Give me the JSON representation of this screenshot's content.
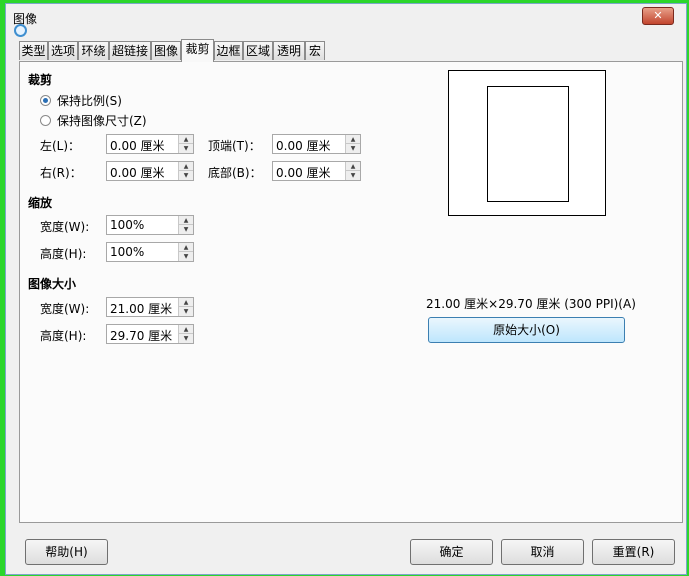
{
  "window": {
    "title": "图像",
    "close_label": "✕"
  },
  "tabs": [
    "类型",
    "选项",
    "环绕",
    "超链接",
    "图像",
    "裁剪",
    "边框",
    "区域",
    "透明",
    "宏"
  ],
  "active_tab": "裁剪",
  "crop": {
    "heading": "裁剪",
    "keep_scale": "保持比例(S)",
    "keep_size": "保持图像尺寸(Z)",
    "left_label": "左(L)：",
    "left_value": "0.00 厘米",
    "right_label": "右(R)：",
    "right_value": "0.00 厘米",
    "top_label": "顶端(T)：",
    "top_value": "0.00 厘米",
    "bottom_label": "底部(B)：",
    "bottom_value": "0.00 厘米"
  },
  "scale": {
    "heading": "缩放",
    "width_label": "宽度(W):",
    "width_value": "100%",
    "height_label": "高度(H):",
    "height_value": "100%"
  },
  "image_size": {
    "heading": "图像大小",
    "width_label": "宽度(W):",
    "width_value": "21.00 厘米",
    "height_label": "高度(H):",
    "height_value": "29.70 厘米"
  },
  "preview": {
    "info": "21.00 厘米×29.70 厘米 (300 PPI)(A)",
    "original_size_button": "原始大小(O)"
  },
  "footer": {
    "help": "帮助(H)",
    "ok": "确定",
    "cancel": "取消",
    "reset": "重置(R)"
  },
  "spin": {
    "up": "▲",
    "down": "▼"
  }
}
